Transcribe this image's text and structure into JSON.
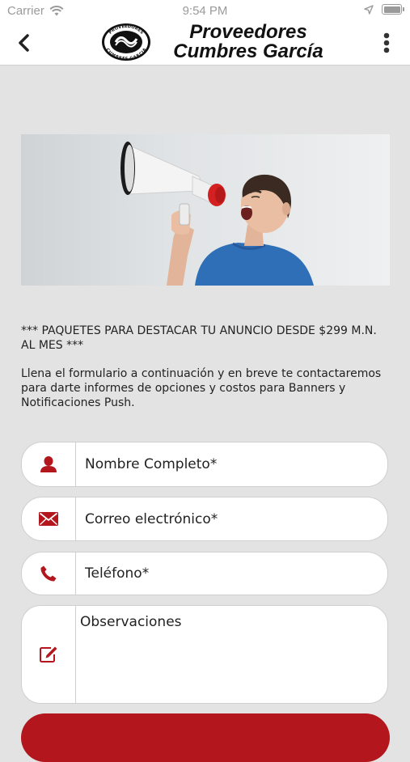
{
  "status_bar": {
    "carrier": "Carrier",
    "time": "9:54 PM"
  },
  "navbar": {
    "brand_line1": "Proveedores",
    "brand_line2": "Cumbres García",
    "badge_top": "PROVEEDORES",
    "badge_bottom": "CUMBRES GARCIA"
  },
  "content": {
    "promo_text": "*** PAQUETES PARA DESTACAR TU ANUNCIO DESDE $299 M.N. AL MES ***",
    "intro_text": "Llena el formulario a continuación y en breve te contactaremos para darte informes de opciones y costos para Banners y Notificaciones Push."
  },
  "form": {
    "name_placeholder": "Nombre Completo*",
    "email_placeholder": "Correo electrónico*",
    "phone_placeholder": "Teléfono*",
    "notes_placeholder": "Observaciones"
  },
  "colors": {
    "accent": "#b3161c",
    "background": "#e3e3e3"
  }
}
